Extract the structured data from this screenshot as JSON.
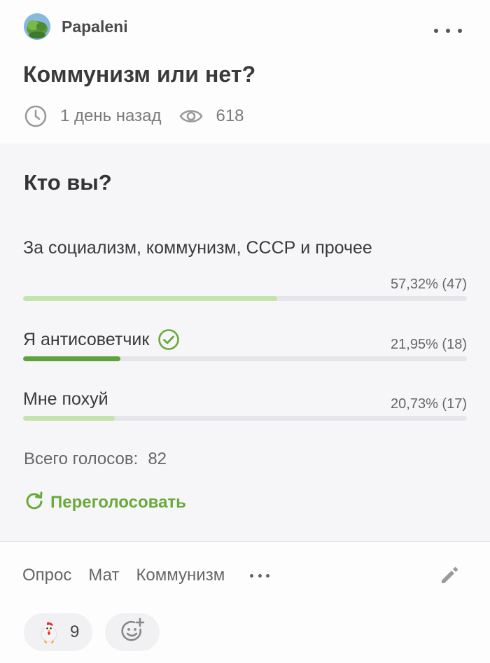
{
  "post": {
    "author": "Papaleni",
    "title": "Коммунизм или нет?",
    "time_ago": "1 день назад",
    "views": "618"
  },
  "poll": {
    "question": "Кто вы?",
    "options": [
      {
        "label": "За социализм, коммунизм, СССР и прочее",
        "percent": "57,32% (47)",
        "fraction": 0.5732,
        "voted": false
      },
      {
        "label": "Я антисоветчик",
        "percent": "21,95% (18)",
        "fraction": 0.2195,
        "voted": true
      },
      {
        "label": "Мне похуй",
        "percent": "20,73% (17)",
        "fraction": 0.2073,
        "voted": false
      }
    ],
    "total_label": "Всего голосов:",
    "total_value": "82",
    "revote_label": "Переголосовать"
  },
  "tags": [
    "Опрос",
    "Мат",
    "Коммунизм"
  ],
  "reactions": {
    "rooster_count": "9"
  },
  "colors": {
    "accent_green": "#6aaa3a",
    "bar_light": "#c5e3ad",
    "bar_voted": "#5fa23c",
    "track": "#e6e6ea"
  },
  "icons": {
    "time": "clock-icon",
    "views": "eye-icon",
    "menu": "more-dots-icon",
    "voted": "check-circle-icon",
    "revote": "refresh-icon",
    "edit": "pencil-icon",
    "reaction": "rooster-icon",
    "add_reaction": "add-emoji-icon"
  }
}
